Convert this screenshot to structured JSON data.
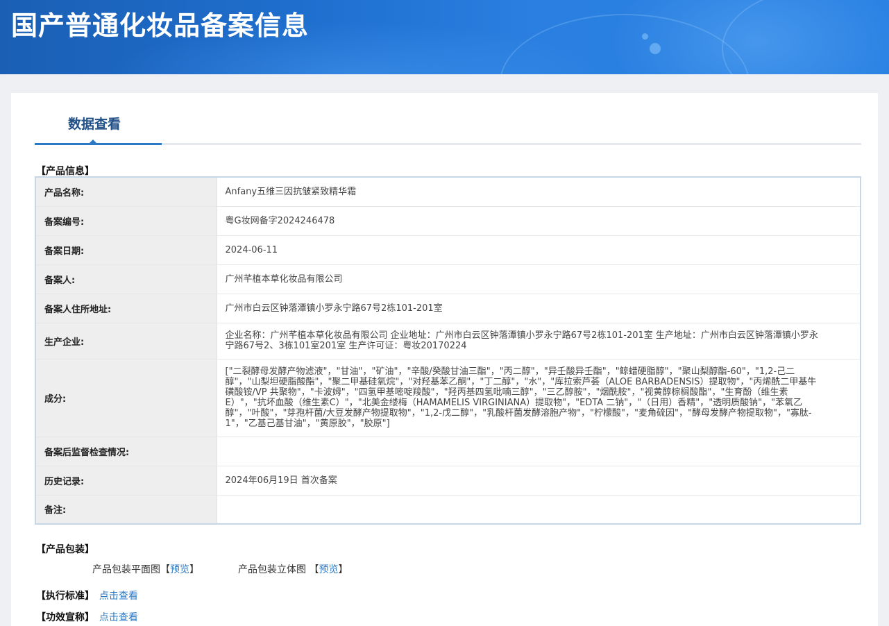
{
  "header": {
    "title": "国产普通化妆品备案信息"
  },
  "tabs": [
    {
      "label": "数据查看"
    }
  ],
  "product_info": {
    "section_title": "【产品信息】",
    "rows": [
      {
        "label": "产品名称:",
        "value": "Anfany五维三因抗皱紧致精华霜"
      },
      {
        "label": "备案编号:",
        "value": "粤G妆网备字2024246478"
      },
      {
        "label": "备案日期:",
        "value": "2024-06-11"
      },
      {
        "label": "备案人:",
        "value": "广州芊植本草化妆品有限公司"
      },
      {
        "label": "备案人住所地址:",
        "value": "广州市白云区钟落潭镇小罗永宁路67号2栋101-201室"
      },
      {
        "label": "生产企业:",
        "value": "企业名称：广州芊植本草化妆品有限公司 企业地址：广州市白云区钟落潭镇小罗永宁路67号2栋101-201室 生产地址：广州市白云区钟落潭镇小罗永宁路67号2、3栋101室201室 生产许可证：粤妆20170224"
      },
      {
        "label": "成分:",
        "value": "[\"二裂酵母发酵产物滤液\"，\"甘油\"，\"矿油\"，\"辛酸/癸酸甘油三酯\"，\"丙二醇\"，\"异壬酸异壬酯\"，\"鲸蜡硬脂醇\"，\"聚山梨醇酯-60\"，\"1,2-己二醇\"，\"山梨坦硬脂酸酯\"，\"聚二甲基硅氧烷\"，\"对羟基苯乙酮\"，\"丁二醇\"，\"水\"，\"库拉索芦荟（ALOE BARBADENSIS）提取物\"，\"丙烯酰二甲基牛磺酸铵/VP 共聚物\"，\"卡波姆\"，\"四氢甲基嘧啶羧酸\"，\"羟丙基四氢吡喃三醇\"，\"三乙醇胺\"，\"烟酰胺\"，\"视黄醇棕榈酸酯\"，\"生育酚（维生素E）\"，\"抗坏血酸（维生素C）\"，\"北美金缕梅（HAMAMELIS VIRGINIANA）提取物\"，\"EDTA 二钠\"，\"（日用）香精\"，\"透明质酸钠\"，\"苯氧乙醇\"，\"叶酸\"，\"芽孢杆菌/大豆发酵产物提取物\"，\"1,2-戊二醇\"，\"乳酸杆菌发酵溶胞产物\"，\"柠檬酸\"，\"麦角硫因\"，\"酵母发酵产物提取物\"，\"寡肽-1\"，\"乙基己基甘油\"，\"黄原胶\"，\"胶原\"]"
      },
      {
        "label": "备案后监督检查情况:",
        "value": ""
      },
      {
        "label": "历史记录:",
        "value": "2024年06月19日 首次备案"
      },
      {
        "label": "备注:",
        "value": ""
      }
    ]
  },
  "packaging": {
    "section_title": "【产品包装】",
    "flat_label": "产品包装平面图",
    "flat_open": "【",
    "flat_link": "预览",
    "flat_close": "】",
    "three_d_label": "产品包装立体图 ",
    "three_d_open": "【",
    "three_d_link": "预览",
    "three_d_close": "】"
  },
  "standard": {
    "section_title": "【执行标准】",
    "link": "点击查看"
  },
  "efficacy": {
    "section_title": "【功效宣称】",
    "link": "点击查看"
  }
}
